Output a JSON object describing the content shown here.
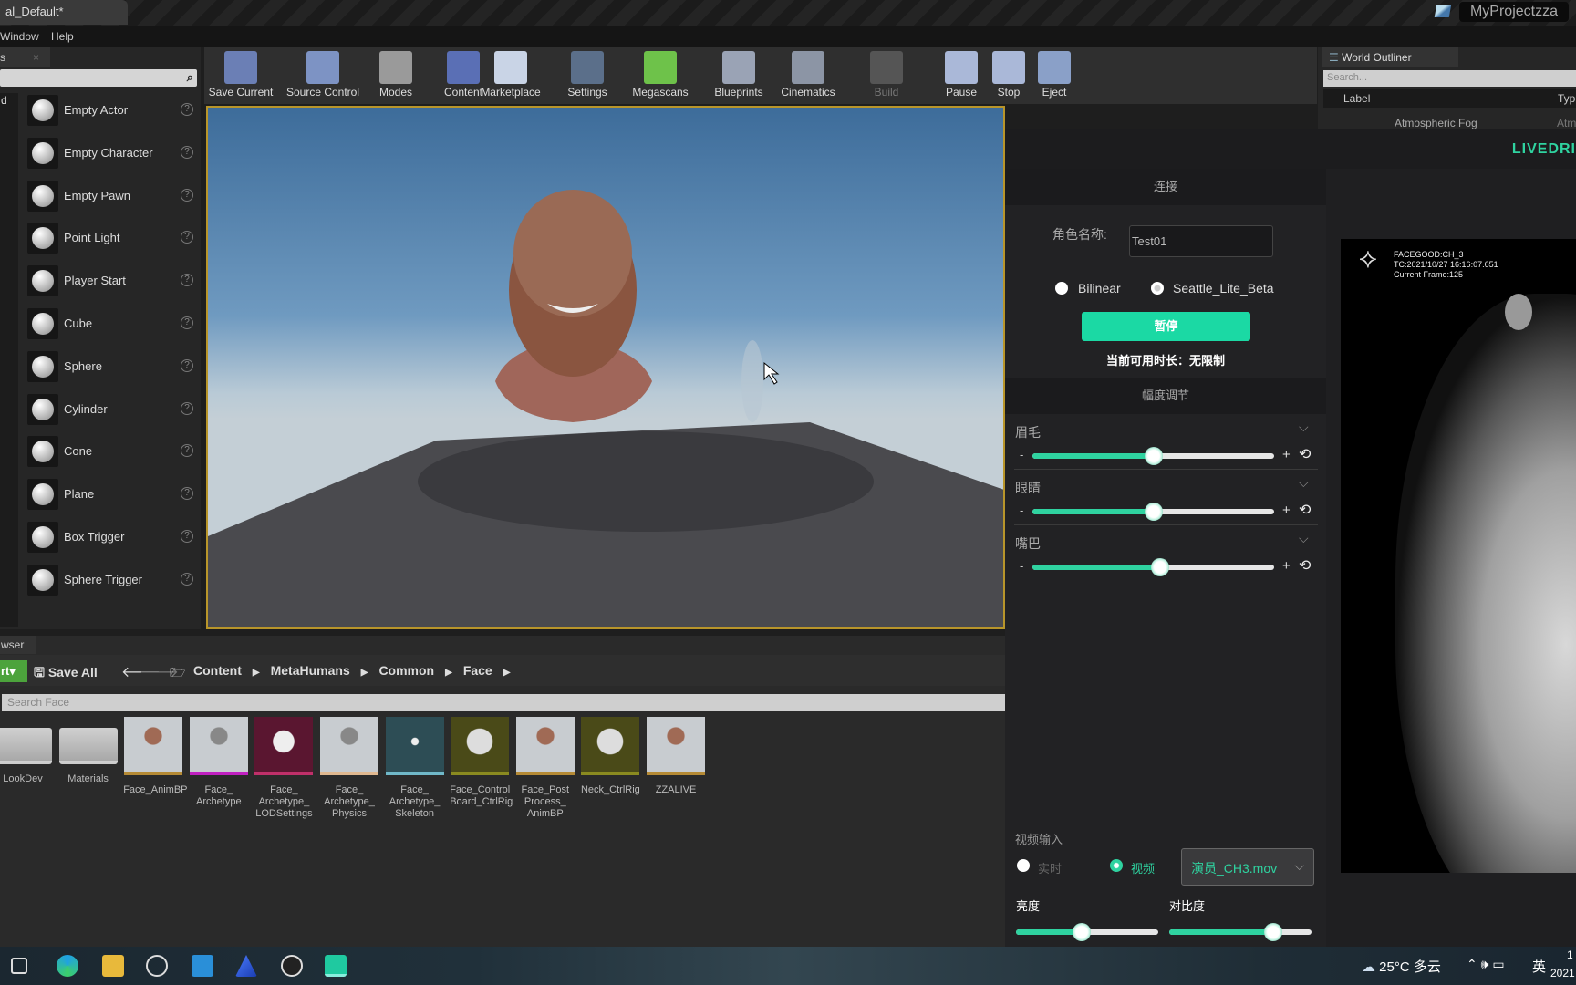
{
  "window": {
    "doc_tab": "al_Default*",
    "project": "MyProjectzza"
  },
  "menu": [
    "Window",
    "Help"
  ],
  "place_actors": {
    "tab": "s",
    "items": [
      "Empty Actor",
      "Empty Character",
      "Empty Pawn",
      "Point Light",
      "Player Start",
      "Cube",
      "Sphere",
      "Cylinder",
      "Cone",
      "Plane",
      "Box Trigger",
      "Sphere Trigger"
    ],
    "side_label": "d",
    "help": "?"
  },
  "toolbar": [
    {
      "label": "Save Current",
      "color": "#6b7fb5"
    },
    {
      "label": "Source Control",
      "color": "#7d93c4"
    },
    {
      "label": "Modes",
      "color": "#9a9a9a"
    },
    {
      "label": "Content",
      "color": "#5a6fb5"
    },
    {
      "label": "Marketplace",
      "color": "#c9d4e6"
    },
    {
      "label": "Settings",
      "color": "#5b6f8a"
    },
    {
      "label": "Megascans",
      "color": "#6ec24a"
    },
    {
      "label": "Blueprints",
      "color": "#9aa3b5"
    },
    {
      "label": "Cinematics",
      "color": "#8c95a5"
    },
    {
      "label": "Build",
      "color": "#555"
    },
    {
      "label": "Pause",
      "color": "#aab8d8"
    },
    {
      "label": "Stop",
      "color": "#aab8d8"
    },
    {
      "label": "Eject",
      "color": "#8aa0c8"
    }
  ],
  "outliner": {
    "title": "World Outliner",
    "search_placeholder": "Search...",
    "col_label": "Label",
    "col_type": "Typ",
    "row": "Atmospheric Fog",
    "row_type": "Atmo"
  },
  "livedrive": {
    "brand": "LIVEDRI",
    "connect_header": "连接",
    "role_label": "角色名称:",
    "role_value": "Test01",
    "radio_a": "Bilinear",
    "radio_b": "Seattle_Lite_Beta",
    "pause_button": "暂停",
    "duration": "当前可用时长：无限制",
    "amplitude_header": "幅度调节",
    "minus": "-",
    "plus": "+",
    "sliders": [
      {
        "label": "眉毛",
        "value": 0.5
      },
      {
        "label": "眼睛",
        "value": 0.5
      },
      {
        "label": "嘴巴",
        "value": 0.53
      }
    ],
    "video_input_label": "视频输入",
    "realtime": "实时",
    "video": "视频",
    "video_file": "演员_CH3.mov",
    "brightness_label": "亮度",
    "brightness": 0.46,
    "contrast_label": "对比度",
    "contrast": 0.73,
    "accent": "#2fd3a0",
    "overlay": [
      "FACEGOOD:CH_3",
      "TC:2021/10/27 16:16:07.651",
      "Current Frame:125"
    ]
  },
  "content_browser": {
    "tab": "wser",
    "add": "rt",
    "save_all": "Save All",
    "breadcrumb": [
      "Content",
      "MetaHumans",
      "Common",
      "Face"
    ],
    "search_placeholder": "Search Face",
    "assets": [
      {
        "name": "LookDev",
        "kind": "folder"
      },
      {
        "name": "Materials",
        "kind": "folder"
      },
      {
        "name": "Face_AnimBP",
        "kind": "head",
        "bar": "#b58a35"
      },
      {
        "name": "Face_ Archetype",
        "kind": "grey",
        "bar": "#c020c0"
      },
      {
        "name": "Face_ Archetype_ LODSettings",
        "kind": "lod",
        "bar": "#c0306a"
      },
      {
        "name": "Face_ Archetype_ Physics",
        "kind": "grey",
        "bar": "#e0b890"
      },
      {
        "name": "Face_ Archetype_ Skeleton",
        "kind": "skel",
        "bar": "#70b8c8"
      },
      {
        "name": "Face_Control Board_CtrlRig",
        "kind": "rig",
        "bar": "#8a8a20"
      },
      {
        "name": "Face_Post Process_ AnimBP",
        "kind": "head",
        "bar": "#b58a35"
      },
      {
        "name": "Neck_CtrlRig",
        "kind": "rig",
        "bar": "#8a8a20"
      },
      {
        "name": "ZZALIVE",
        "kind": "head",
        "bar": "#b58a35"
      }
    ]
  },
  "taskbar": {
    "weather": "25°C 多云",
    "ime": "英",
    "clock_top": "1",
    "clock_bottom": "2021"
  }
}
